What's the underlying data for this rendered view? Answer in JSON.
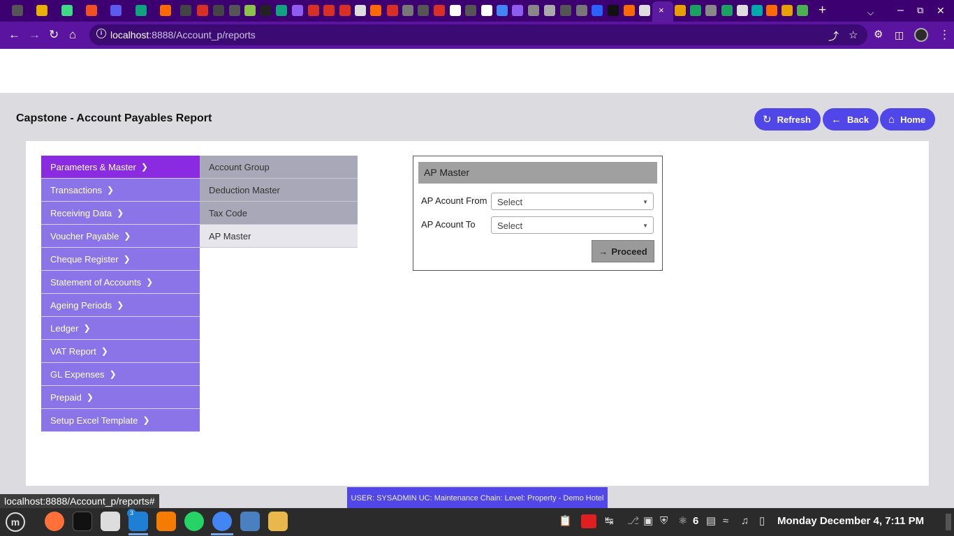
{
  "browser": {
    "url_host": "localhost",
    "url_path": ":8888/Account_p/reports",
    "tab_close": "×",
    "new_tab": "+",
    "hover_url": "localhost:8888/Account_p/reports#"
  },
  "page": {
    "title": "Capstone - Account Payables Report"
  },
  "header_buttons": {
    "refresh": "Refresh",
    "back": "Back",
    "home": "Home"
  },
  "menu": {
    "items": [
      {
        "label": "Parameters & Master"
      },
      {
        "label": "Transactions"
      },
      {
        "label": "Receiving Data"
      },
      {
        "label": "Voucher Payable"
      },
      {
        "label": "Cheque Register"
      },
      {
        "label": "Statement of Accounts"
      },
      {
        "label": "Ageing Periods"
      },
      {
        "label": "Ledger"
      },
      {
        "label": "VAT Report"
      },
      {
        "label": "GL Expenses"
      },
      {
        "label": "Prepaid"
      },
      {
        "label": "Setup Excel Template"
      }
    ]
  },
  "submenu": {
    "items": [
      {
        "label": "Account Group"
      },
      {
        "label": "Deduction Master"
      },
      {
        "label": "Tax Code"
      },
      {
        "label": "AP Master"
      }
    ]
  },
  "ap_master": {
    "title": "AP Master",
    "from_label": "AP Acount From",
    "to_label": "AP Acount To",
    "from_value": "Select",
    "to_value": "Select",
    "proceed_label": "Proceed"
  },
  "status": {
    "user_info": "USER: SYSADMIN UC: Maintenance Chain: Level: Property - Demo Hotel"
  },
  "taskbar": {
    "vscode_badge": "3",
    "notif_count": "6",
    "clock": "Monday December  4, 7:11 PM"
  },
  "colors": {
    "accent": "#5146e8",
    "menu": "#8a74e8",
    "menu_active": "#8a2be2",
    "browser": "#5a14a0"
  }
}
